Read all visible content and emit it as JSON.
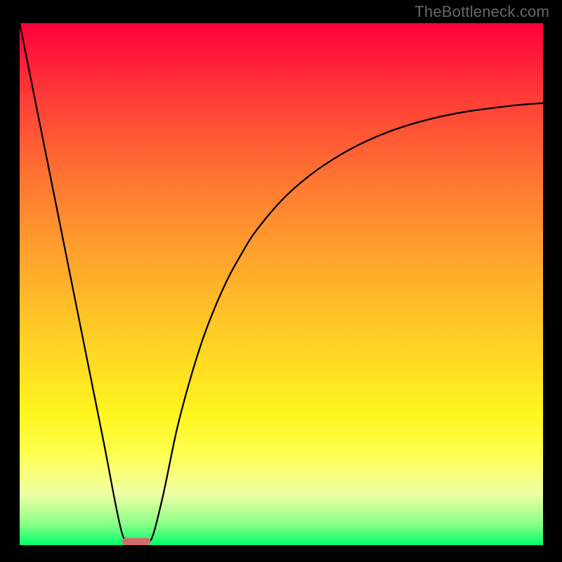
{
  "watermark": "TheBottleneck.com",
  "chart_data": {
    "type": "line",
    "title": "",
    "xlabel": "",
    "ylabel": "",
    "xlim": [
      0,
      100
    ],
    "ylim": [
      0,
      100
    ],
    "gradient_colors": [
      {
        "stop": 0.0,
        "hex": "#fe003a"
      },
      {
        "stop": 0.15,
        "hex": "#ff3f37"
      },
      {
        "stop": 0.3,
        "hex": "#ff7632"
      },
      {
        "stop": 0.45,
        "hex": "#ffa42c"
      },
      {
        "stop": 0.6,
        "hex": "#ffce25"
      },
      {
        "stop": 0.75,
        "hex": "#fff61e"
      },
      {
        "stop": 0.82,
        "hex": "#feff4c"
      },
      {
        "stop": 0.9,
        "hex": "#f2ffa4"
      },
      {
        "stop": 0.96,
        "hex": "#8aff87"
      },
      {
        "stop": 1.0,
        "hex": "#00ff69"
      }
    ],
    "series": [
      {
        "name": "curve",
        "color": "#000000",
        "x": [
          0,
          4,
          8,
          12,
          16,
          19.5,
          21.5,
          23.5,
          24.5,
          25.5,
          27.5,
          30,
          32.5,
          35,
          37.5,
          40,
          42.5,
          45,
          50,
          55,
          60,
          65,
          70,
          75,
          80,
          85,
          90,
          95,
          100
        ],
        "y": [
          100,
          80,
          60,
          40,
          20,
          2.5,
          0.7,
          0.7,
          0.7,
          2,
          10,
          22,
          31.5,
          39.5,
          46,
          51.5,
          56,
          60,
          66,
          70.5,
          74,
          76.8,
          79,
          80.7,
          82,
          83,
          83.7,
          84.3,
          84.7
        ]
      }
    ],
    "marker": {
      "x_center": 22.3,
      "y_center": 0.7,
      "width": 5.4,
      "height": 1.4,
      "rx": 0.7,
      "color": "#d26b6b"
    }
  }
}
